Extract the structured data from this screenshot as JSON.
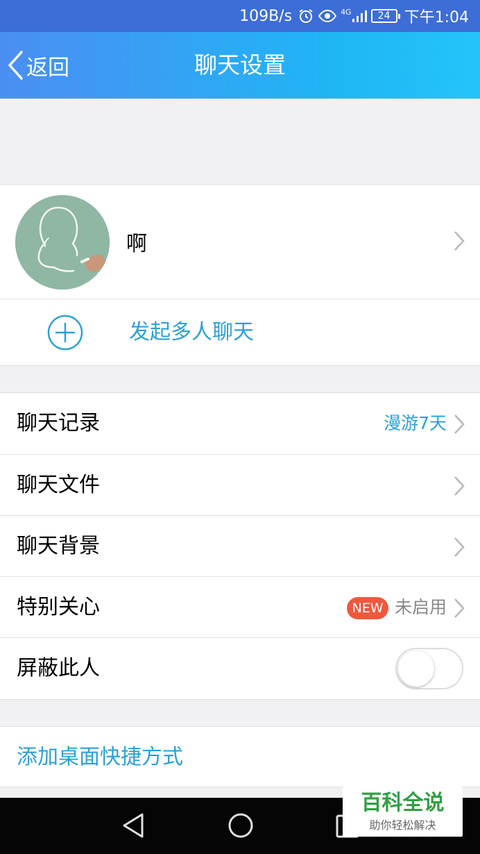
{
  "status_bar": {
    "network_speed": "109B/s",
    "signal": "4G",
    "battery": "24",
    "time": "下午1:04",
    "icons": [
      "alarm-icon",
      "eye-icon",
      "signal-icon",
      "battery-icon"
    ]
  },
  "nav": {
    "back_label": "返回",
    "title": "聊天设置"
  },
  "profile": {
    "name": "啊",
    "group_chat_label": "发起多人聊天"
  },
  "settings": {
    "items": [
      {
        "label": "聊天记录",
        "value": "漫游7天"
      },
      {
        "label": "聊天文件"
      },
      {
        "label": "聊天背景"
      },
      {
        "label": "特别关心",
        "badge": "NEW",
        "value": "未启用"
      },
      {
        "label": "屏蔽此人",
        "toggle": false
      }
    ]
  },
  "shortcut": {
    "label": "添加桌面快捷方式"
  },
  "watermark": {
    "title": "百科全说",
    "subtitle": "助你轻松解决"
  },
  "colors": {
    "accent": "#2ba0d8",
    "nav_gradient_start": "#4b8ef2",
    "nav_gradient_end": "#24c4fa",
    "badge": "#f0583c",
    "background": "#f1f1f4"
  }
}
